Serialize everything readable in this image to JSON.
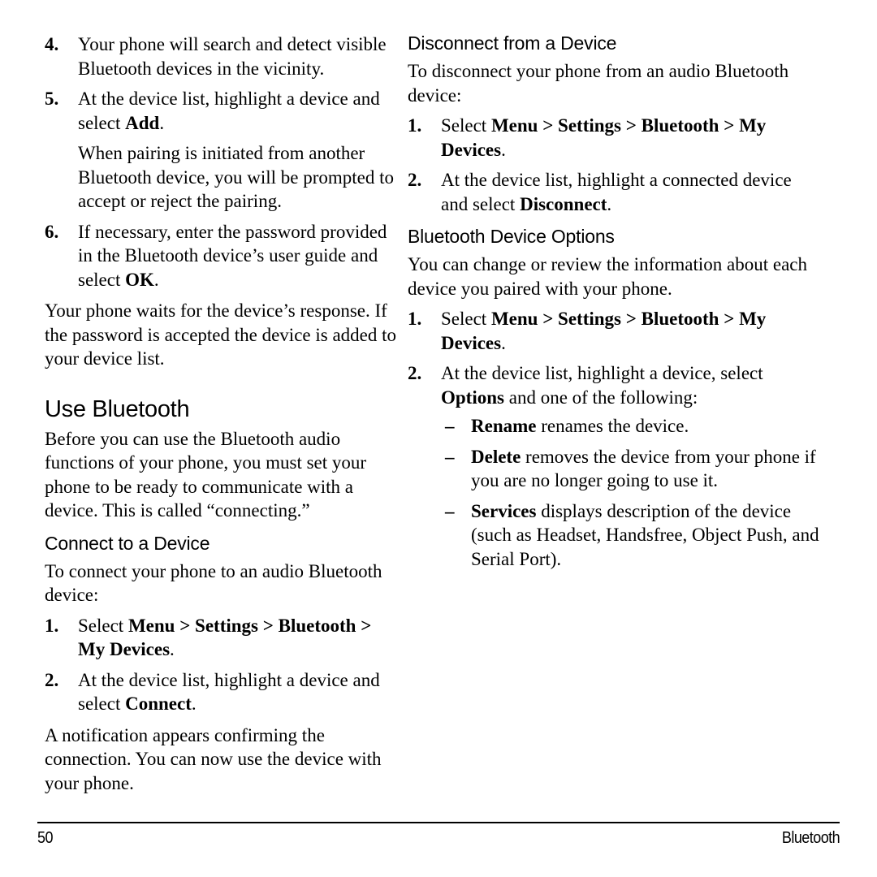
{
  "document": {
    "kind": "phone-user-guide-page",
    "page_number": "50",
    "running_title": "Bluetooth"
  },
  "left_column": {
    "blocks": [
      {
        "type": "numbered_item",
        "number": "4.",
        "text": "Your phone will search and detect visible Bluetooth devices in the vicinity."
      },
      {
        "type": "numbered_item",
        "number": "5.",
        "text_parts": [
          {
            "t": "At the device list, highlight a device and select ",
            "b": false
          },
          {
            "t": "Add",
            "b": true
          },
          {
            "t": ".",
            "b": false
          }
        ]
      },
      {
        "type": "continuation",
        "text": "When pairing is initiated from another Bluetooth device, you will be prompted to accept or reject the pairing."
      },
      {
        "type": "numbered_item",
        "number": "6.",
        "text_parts": [
          {
            "t": "If necessary, enter the password provided in the Bluetooth device’s user guide and select ",
            "b": false
          },
          {
            "t": "OK",
            "b": true
          },
          {
            "t": ".",
            "b": false
          }
        ]
      },
      {
        "type": "paragraph",
        "text": "Your phone waits for the device’s response. If the password is accepted the device is added to your device list."
      },
      {
        "type": "heading1",
        "text": "Use Bluetooth"
      },
      {
        "type": "paragraph",
        "text": "Before you can use the Bluetooth audio functions of your phone, you must set your phone to be ready to communicate with a device. This is called “connecting.”"
      },
      {
        "type": "heading2",
        "text": "Connect to a Device"
      },
      {
        "type": "paragraph",
        "text": "To connect your phone to an audio Bluetooth device:"
      },
      {
        "type": "numbered_item",
        "number": "1.",
        "text_parts": [
          {
            "t": "Select ",
            "b": false
          },
          {
            "t": "Menu > Settings > Bluetooth > My Devices",
            "b": true
          },
          {
            "t": ".",
            "b": false
          }
        ]
      },
      {
        "type": "numbered_item",
        "number": "2.",
        "text_parts": [
          {
            "t": "At the device list, highlight a device and select ",
            "b": false
          },
          {
            "t": "Connect",
            "b": true
          },
          {
            "t": ".",
            "b": false
          }
        ]
      },
      {
        "type": "paragraph",
        "text": "A notification appears confirming the connection. You can now use the device with your phone."
      }
    ]
  },
  "right_column": {
    "blocks": [
      {
        "type": "heading2",
        "text": "Disconnect from a Device"
      },
      {
        "type": "paragraph",
        "text": "To disconnect your phone from an audio Bluetooth device:"
      },
      {
        "type": "numbered_item",
        "number": "1.",
        "text_parts": [
          {
            "t": "Select ",
            "b": false
          },
          {
            "t": "Menu  > Settings > Bluetooth > My Devices",
            "b": true
          },
          {
            "t": ".",
            "b": false
          }
        ]
      },
      {
        "type": "numbered_item",
        "number": "2.",
        "text_parts": [
          {
            "t": "At the device list, highlight a connected device and select ",
            "b": false
          },
          {
            "t": "Disconnect",
            "b": true
          },
          {
            "t": ".",
            "b": false
          }
        ]
      },
      {
        "type": "heading2",
        "text": "Bluetooth Device Options"
      },
      {
        "type": "paragraph",
        "text": "You can change or review the information about each device you paired with your phone."
      },
      {
        "type": "numbered_item",
        "number": "1.",
        "text_parts": [
          {
            "t": "Select ",
            "b": false
          },
          {
            "t": "Menu  > Settings > Bluetooth > My Devices",
            "b": true
          },
          {
            "t": ".",
            "b": false
          }
        ]
      },
      {
        "type": "numbered_item",
        "number": "2.",
        "text_parts": [
          {
            "t": "At the device list, highlight a device, select ",
            "b": false
          },
          {
            "t": "Options",
            "b": true
          },
          {
            "t": " and one of the following:",
            "b": false
          }
        ]
      },
      {
        "type": "dash_item",
        "dash": "–",
        "text_parts": [
          {
            "t": "Rename",
            "b": true
          },
          {
            "t": " renames the device.",
            "b": false
          }
        ]
      },
      {
        "type": "dash_item",
        "dash": "–",
        "text_parts": [
          {
            "t": "Delete",
            "b": true
          },
          {
            "t": " removes the device from your phone if you are no longer going to use it.",
            "b": false
          }
        ]
      },
      {
        "type": "dash_item",
        "dash": "–",
        "text_parts": [
          {
            "t": "Services",
            "b": true
          },
          {
            "t": " displays description of the device (such as Headset, Handsfree, Object Push, and Serial Port).",
            "b": false
          }
        ]
      }
    ]
  },
  "footer": {
    "page_number": "50",
    "section_title": "Bluetooth"
  }
}
